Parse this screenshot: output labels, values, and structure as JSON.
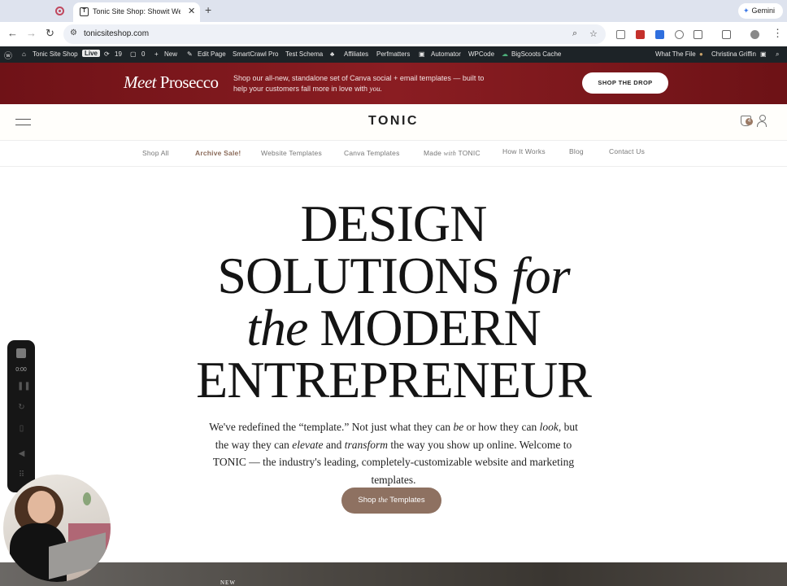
{
  "browser": {
    "tab_title": "Tonic Site Shop: Showit Website Templates",
    "tab_favicon": "T",
    "url": "tonicsiteshop.com",
    "gemini_label": "Gemini"
  },
  "wp_admin": {
    "site_name": "Tonic Site Shop",
    "live_badge": "Live",
    "updates_count": "19",
    "comments_count": "0",
    "items": [
      "New",
      "Edit Page",
      "SmartCrawl Pro",
      "Test Schema",
      "Affiliates",
      "Perfmatters",
      "Automator",
      "WPCode",
      "BigScoots Cache"
    ],
    "what_the_file": "What The File",
    "user_name": "Christina Griffin"
  },
  "promo": {
    "title_italic": "Meet",
    "title_rest": "Prosecco",
    "text": "Shop our all-new, standalone set of Canva social + email templates — built to help your customers fall more in love with ",
    "text_italic": "you.",
    "button": "SHOP THE DROP"
  },
  "header": {
    "logo": "TONIC",
    "cart_count": "4"
  },
  "nav": {
    "shop_all": "Shop All",
    "archive_sale": "Archive Sale!",
    "website_templates": "Website Templates",
    "canva_templates": "Canva Templates",
    "made_with_pre": "Made",
    "made_with_em": "with",
    "made_with_post": "TONIC",
    "how_it_works": "How It Works",
    "blog": "Blog",
    "contact": "Contact Us"
  },
  "hero": {
    "line1": "DESIGN",
    "line2_a": "SOLUTIONS",
    "line2_b": "for",
    "line3_a": "the",
    "line3_b": "MODERN",
    "line4": "ENTREPRENEUR",
    "copy_1": "We've redefined the “template.” Not just what they can ",
    "copy_be": "be",
    "copy_2": " or how they can ",
    "copy_look": "look",
    "copy_3": ", but the way they can ",
    "copy_elevate": "elevate",
    "copy_4": " and ",
    "copy_transform": "transform",
    "copy_5": " the way you show up online. Welcome to TONIC  — the industry's leading, completely-customizable website and marketing templates.",
    "cta_pre": "Shop",
    "cta_em": "the",
    "cta_post": "Templates"
  },
  "bottom": {
    "label": "NEW"
  },
  "recorder": {
    "time": "0:00"
  }
}
